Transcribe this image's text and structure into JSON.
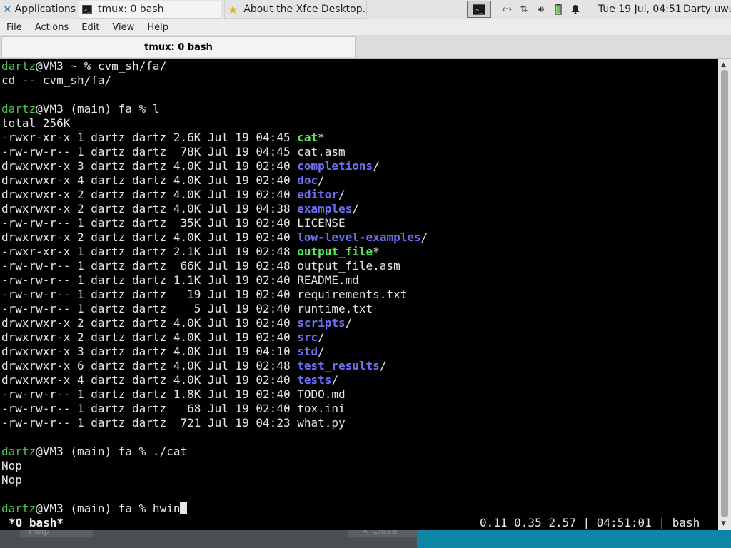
{
  "panel": {
    "applications_label": "Applications",
    "tasks": [
      {
        "label": "tmux: 0 bash"
      },
      {
        "label": "About the Xfce Desktop..."
      }
    ],
    "clock": "Tue 19 Jul, 04:51",
    "user": "Darty uwu",
    "tray_icons": [
      "network-arrows-icon",
      "transfer-icon",
      "volume-icon",
      "battery-icon",
      "bell-icon"
    ]
  },
  "window": {
    "menu": [
      "File",
      "Actions",
      "Edit",
      "View",
      "Help"
    ],
    "tab_title": "tmux: 0 bash"
  },
  "terminal": {
    "lines": [
      [
        {
          "t": "dartz",
          "c": "g"
        },
        {
          "t": "@VM3 ~ % cvm_sh/fa/"
        }
      ],
      [
        {
          "t": "cd -- cvm_sh/fa/"
        }
      ],
      [],
      [
        {
          "t": "dartz",
          "c": "g"
        },
        {
          "t": "@VM3 (main) fa % l"
        }
      ],
      [
        {
          "t": "total 256K"
        }
      ],
      [
        {
          "t": "-rwxr-xr-x 1 dartz dartz 2.6K Jul 19 04:45 "
        },
        {
          "t": "cat",
          "c": "exe"
        },
        {
          "t": "*"
        }
      ],
      [
        {
          "t": "-rw-rw-r-- 1 dartz dartz  78K Jul 19 04:45 cat.asm"
        }
      ],
      [
        {
          "t": "drwxrwxr-x 3 dartz dartz 4.0K Jul 19 02:40 "
        },
        {
          "t": "completions",
          "c": "dir"
        },
        {
          "t": "/"
        }
      ],
      [
        {
          "t": "drwxrwxr-x 4 dartz dartz 4.0K Jul 19 02:40 "
        },
        {
          "t": "doc",
          "c": "dir"
        },
        {
          "t": "/"
        }
      ],
      [
        {
          "t": "drwxrwxr-x 2 dartz dartz 4.0K Jul 19 02:40 "
        },
        {
          "t": "editor",
          "c": "dir"
        },
        {
          "t": "/"
        }
      ],
      [
        {
          "t": "drwxrwxr-x 2 dartz dartz 4.0K Jul 19 04:38 "
        },
        {
          "t": "examples",
          "c": "dir"
        },
        {
          "t": "/"
        }
      ],
      [
        {
          "t": "-rw-rw-r-- 1 dartz dartz  35K Jul 19 02:40 LICENSE"
        }
      ],
      [
        {
          "t": "drwxrwxr-x 2 dartz dartz 4.0K Jul 19 02:40 "
        },
        {
          "t": "low-level-examples",
          "c": "dir"
        },
        {
          "t": "/"
        }
      ],
      [
        {
          "t": "-rwxr-xr-x 1 dartz dartz 2.1K Jul 19 02:48 "
        },
        {
          "t": "output_file",
          "c": "exe"
        },
        {
          "t": "*"
        }
      ],
      [
        {
          "t": "-rw-rw-r-- 1 dartz dartz  66K Jul 19 02:48 output_file.asm"
        }
      ],
      [
        {
          "t": "-rw-rw-r-- 1 dartz dartz 1.1K Jul 19 02:40 README.md"
        }
      ],
      [
        {
          "t": "-rw-rw-r-- 1 dartz dartz   19 Jul 19 02:40 requirements.txt"
        }
      ],
      [
        {
          "t": "-rw-rw-r-- 1 dartz dartz    5 Jul 19 02:40 runtime.txt"
        }
      ],
      [
        {
          "t": "drwxrwxr-x 2 dartz dartz 4.0K Jul 19 02:40 "
        },
        {
          "t": "scripts",
          "c": "dir"
        },
        {
          "t": "/"
        }
      ],
      [
        {
          "t": "drwxrwxr-x 2 dartz dartz 4.0K Jul 19 02:40 "
        },
        {
          "t": "src",
          "c": "dir"
        },
        {
          "t": "/"
        }
      ],
      [
        {
          "t": "drwxrwxr-x 3 dartz dartz 4.0K Jul 19 04:10 "
        },
        {
          "t": "std",
          "c": "dir"
        },
        {
          "t": "/"
        }
      ],
      [
        {
          "t": "drwxrwxr-x 6 dartz dartz 4.0K Jul 19 02:48 "
        },
        {
          "t": "test_results",
          "c": "dir"
        },
        {
          "t": "/"
        }
      ],
      [
        {
          "t": "drwxrwxr-x 4 dartz dartz 4.0K Jul 19 02:40 "
        },
        {
          "t": "tests",
          "c": "dir"
        },
        {
          "t": "/"
        }
      ],
      [
        {
          "t": "-rw-rw-r-- 1 dartz dartz 1.8K Jul 19 02:40 TODO.md"
        }
      ],
      [
        {
          "t": "-rw-rw-r-- 1 dartz dartz   68 Jul 19 02:40 tox.ini"
        }
      ],
      [
        {
          "t": "-rw-rw-r-- 1 dartz dartz  721 Jul 19 04:23 what.py"
        }
      ],
      [],
      [
        {
          "t": "dartz",
          "c": "g"
        },
        {
          "t": "@VM3 (main) fa % ./cat"
        }
      ],
      [
        {
          "t": "Nop"
        }
      ],
      [
        {
          "t": "Nop"
        }
      ],
      [],
      [
        {
          "t": "dartz",
          "c": "g"
        },
        {
          "t": "@VM3 (main) fa % hwin"
        }
      ]
    ],
    "status_window": "*0 bash*",
    "status_right": "0.11 0.35 2.57 | 04:51:01 | bash"
  },
  "background_window": {
    "help_label": "Help",
    "close_label": "✕ Close"
  },
  "colors": {
    "prompt_user": "#4fc24f",
    "directory": "#6f6ff5",
    "executable": "#58e858",
    "terminal_bg": "#000000",
    "desktop_accent": "#0d86a6"
  }
}
